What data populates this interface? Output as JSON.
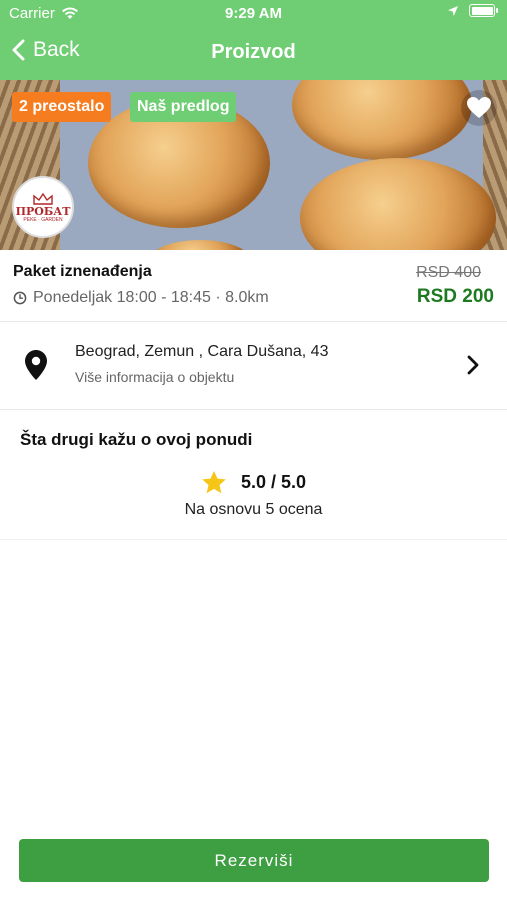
{
  "status_bar": {
    "carrier": "Carrier",
    "time": "9:29 AM"
  },
  "nav": {
    "back_label": "Back",
    "title": "Proizvod"
  },
  "hero": {
    "badge_left": "2 preostalo",
    "badge_right": "Naš predlog",
    "logo_text": "ПРОБАТ",
    "logo_subtext": "PEKE · GARDEN"
  },
  "product": {
    "name": "Paket iznenađenja",
    "schedule": "Ponedeljak 18:00 - 18:45 · 8.0km",
    "old_price": "RSD 400",
    "price": "RSD 200"
  },
  "location": {
    "address": "Beograd, Zemun , Cara Dušana, 43",
    "more_info": "Više informacija o objektu"
  },
  "reviews": {
    "title": "Šta drugi kažu o ovoj ponudi",
    "rating": "5.0 / 5.0",
    "basis": "Na osnovu 5 ocena"
  },
  "actions": {
    "reserve_label": "Rezerviši"
  },
  "colors": {
    "header_green": "#6fcd73",
    "price_green": "#1d7a21",
    "button_green": "#3e9e42",
    "badge_orange": "#f57c1f",
    "star_yellow": "#f5c518"
  }
}
